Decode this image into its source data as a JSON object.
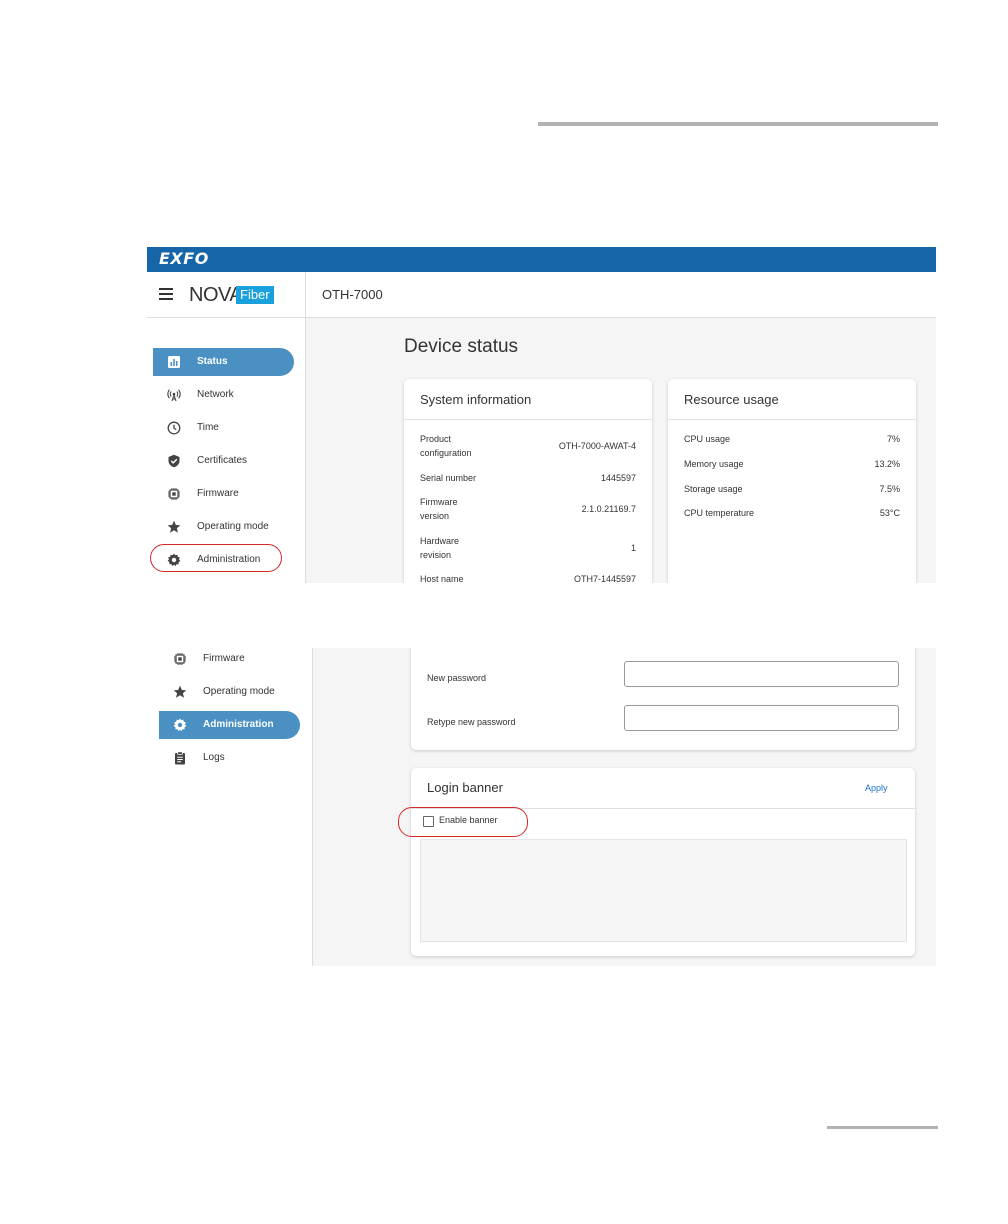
{
  "top": {
    "brand": "EXFO",
    "product_name": "NOVA",
    "product_suffix": "Fiber",
    "device_name": "OTH-7000",
    "nav": [
      {
        "label": "Status",
        "icon": "bar-chart-icon",
        "active": true
      },
      {
        "label": "Network",
        "icon": "antenna-icon"
      },
      {
        "label": "Time",
        "icon": "clock-icon"
      },
      {
        "label": "Certificates",
        "icon": "shield-check-icon"
      },
      {
        "label": "Firmware",
        "icon": "chip-icon"
      },
      {
        "label": "Operating mode",
        "icon": "star-icon"
      },
      {
        "label": "Administration",
        "icon": "gear-icon"
      }
    ],
    "page_title": "Device status",
    "system_info": {
      "title": "System information",
      "rows": [
        {
          "label": "Product configuration",
          "value": "OTH-7000-AWAT-4"
        },
        {
          "label": "Serial number",
          "value": "1445597"
        },
        {
          "label": "Firmware version",
          "value": "2.1.0.21169.7"
        },
        {
          "label": "Hardware revision",
          "value": "1"
        },
        {
          "label": "Host name",
          "value": "OTH7-1445597"
        }
      ]
    },
    "resource_usage": {
      "title": "Resource usage",
      "rows": [
        {
          "label": "CPU usage",
          "value": "7%"
        },
        {
          "label": "Memory usage",
          "value": "13.2%"
        },
        {
          "label": "Storage usage",
          "value": "7.5%"
        },
        {
          "label": "CPU temperature",
          "value": "53°C"
        }
      ]
    }
  },
  "bottom": {
    "nav": [
      {
        "label": "Firmware",
        "icon": "chip-icon"
      },
      {
        "label": "Operating mode",
        "icon": "star-icon"
      },
      {
        "label": "Administration",
        "icon": "gear-icon",
        "active": true
      },
      {
        "label": "Logs",
        "icon": "clipboard-icon"
      }
    ],
    "new_password_label": "New password",
    "retype_password_label": "Retype new password",
    "new_password_value": "",
    "retype_password_value": "",
    "login_banner": {
      "title": "Login banner",
      "apply_label": "Apply",
      "enable_label": "Enable banner",
      "enabled": false,
      "banner_text": ""
    }
  },
  "colors": {
    "brand_bar": "#1565a8",
    "active_nav": "#4a90c2",
    "callout": "#d42a2a",
    "link": "#1a73c9"
  }
}
